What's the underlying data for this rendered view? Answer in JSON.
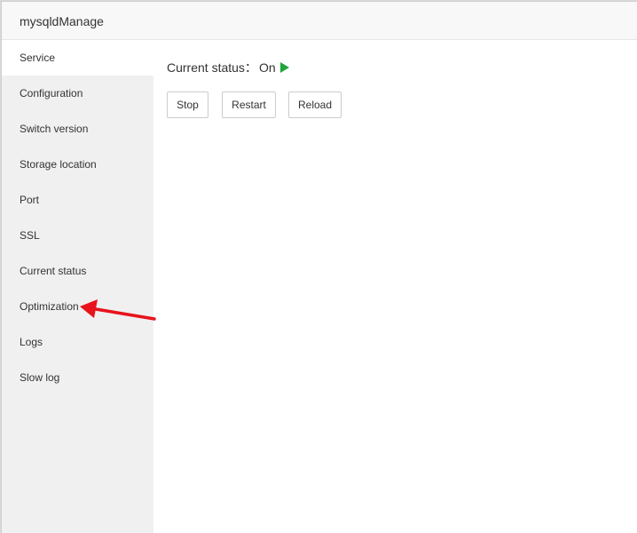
{
  "window": {
    "title": "mysqldManage"
  },
  "sidebar": {
    "items": [
      {
        "label": "Service",
        "active": true
      },
      {
        "label": "Configuration",
        "active": false
      },
      {
        "label": "Switch version",
        "active": false
      },
      {
        "label": "Storage location",
        "active": false
      },
      {
        "label": "Port",
        "active": false
      },
      {
        "label": "SSL",
        "active": false
      },
      {
        "label": "Current status",
        "active": false
      },
      {
        "label": "Optimization",
        "active": false
      },
      {
        "label": "Logs",
        "active": false
      },
      {
        "label": "Slow log",
        "active": false
      }
    ]
  },
  "service": {
    "status_label": "Current status：",
    "status_value": "On",
    "status_icon": "play-icon",
    "status_color": "#20a53a",
    "buttons": {
      "stop": "Stop",
      "restart": "Restart",
      "reload": "Reload"
    }
  },
  "annotation": {
    "arrow_color": "#e8131b",
    "points_to": "Optimization"
  }
}
